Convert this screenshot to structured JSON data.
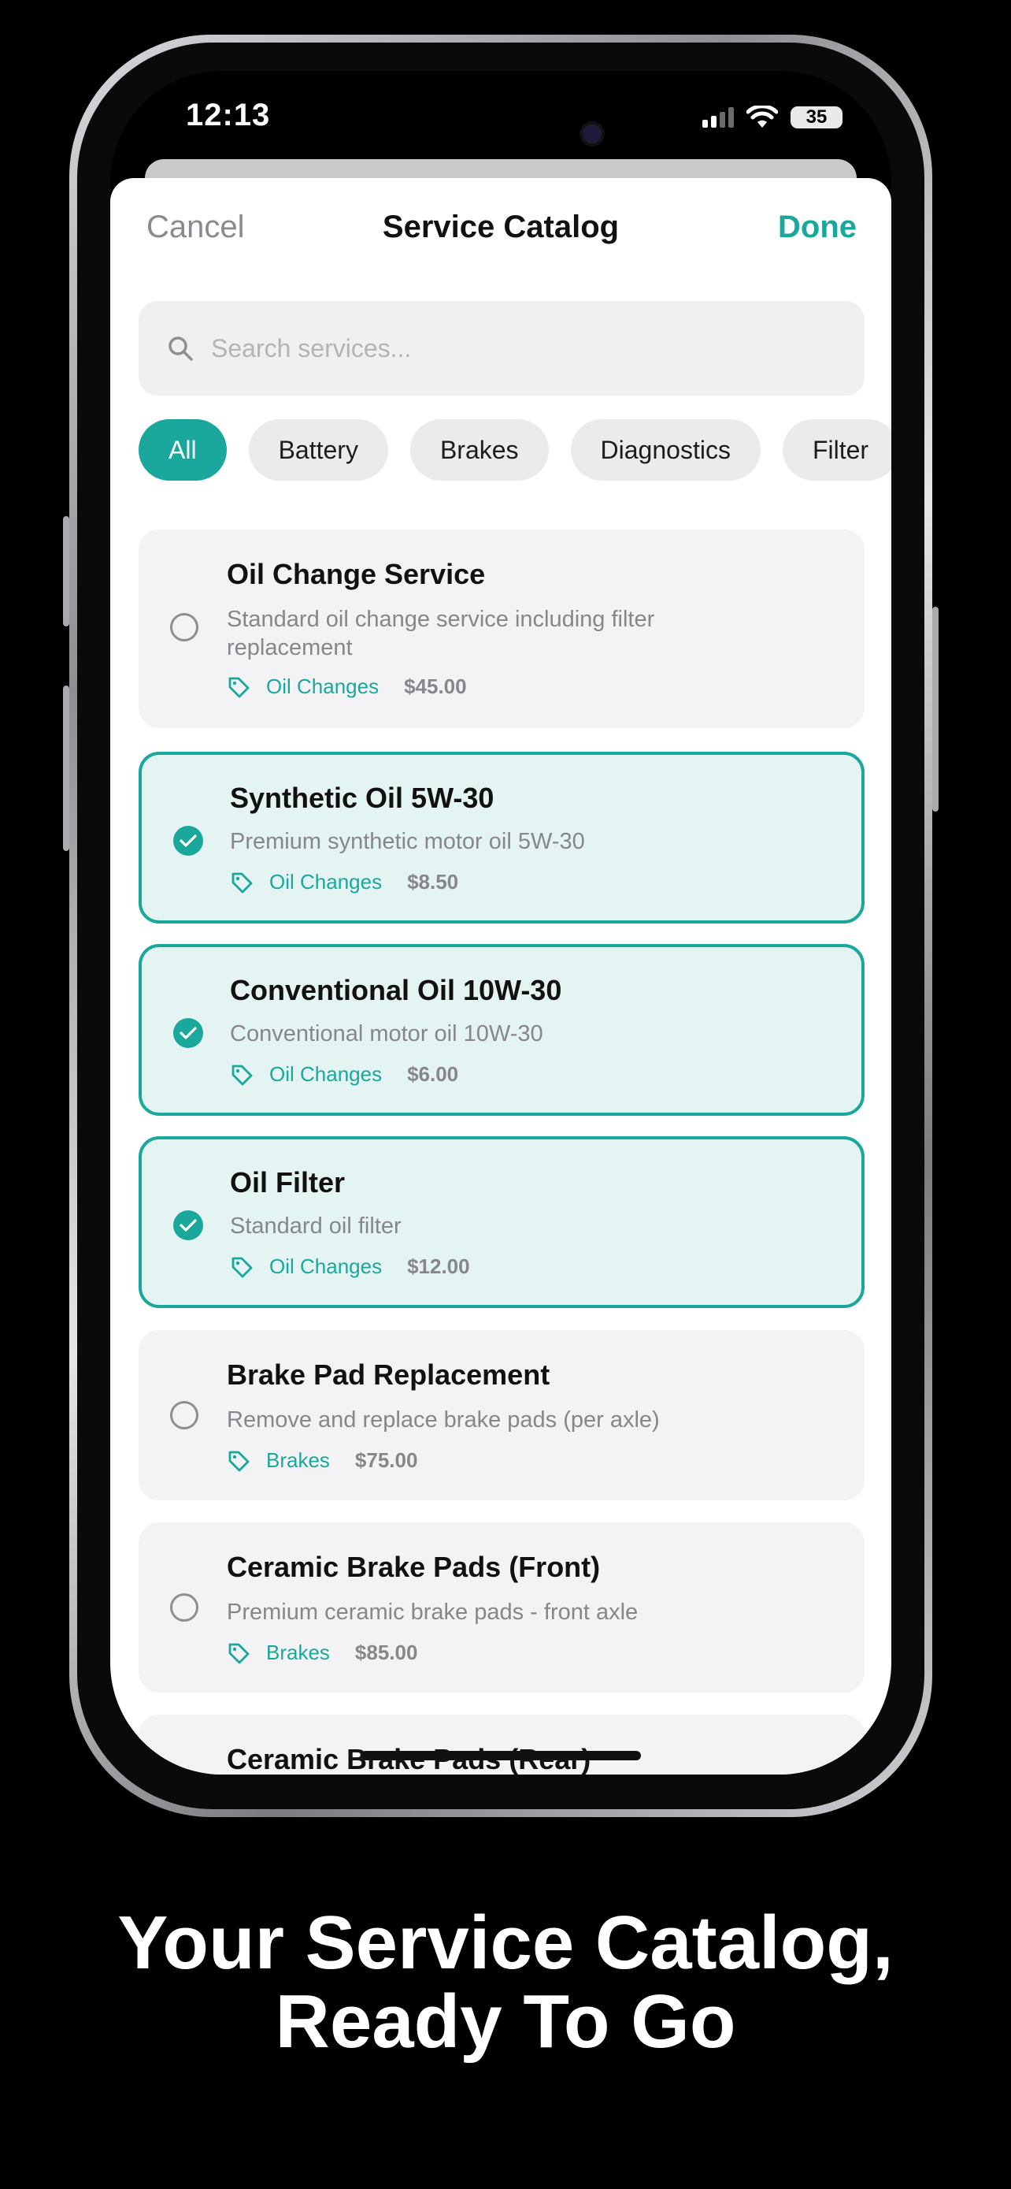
{
  "status": {
    "time": "12:13",
    "battery": "35"
  },
  "nav": {
    "cancel": "Cancel",
    "title": "Service Catalog",
    "done": "Done"
  },
  "search": {
    "placeholder": "Search services..."
  },
  "chips": [
    {
      "label": "All",
      "active": true
    },
    {
      "label": "Battery"
    },
    {
      "label": "Brakes"
    },
    {
      "label": "Diagnostics"
    },
    {
      "label": "Filter"
    }
  ],
  "services": [
    {
      "title": "Oil Change Service",
      "desc": "Standard oil change service including filter replacement",
      "category": "Oil Changes",
      "price": "$45.00",
      "selected": false
    },
    {
      "title": "Synthetic Oil 5W-30",
      "desc": "Premium synthetic motor oil 5W-30",
      "category": "Oil Changes",
      "price": "$8.50",
      "selected": true
    },
    {
      "title": "Conventional Oil 10W-30",
      "desc": "Conventional motor oil 10W-30",
      "category": "Oil Changes",
      "price": "$6.00",
      "selected": true
    },
    {
      "title": "Oil Filter",
      "desc": "Standard oil filter",
      "category": "Oil Changes",
      "price": "$12.00",
      "selected": true
    },
    {
      "title": "Brake Pad Replacement",
      "desc": "Remove and replace brake pads (per axle)",
      "category": "Brakes",
      "price": "$75.00",
      "selected": false
    },
    {
      "title": "Ceramic Brake Pads (Front)",
      "desc": "Premium ceramic brake pads - front axle",
      "category": "Brakes",
      "price": "$85.00",
      "selected": false
    },
    {
      "title": "Ceramic Brake Pads (Rear)"
    }
  ],
  "caption": {
    "line1": "Your Service Catalog,",
    "line2": "Ready To Go"
  },
  "colors": {
    "accent": "#1aa89c",
    "selected_bg": "#e4f4f3",
    "card_bg": "#f3f3f5"
  }
}
